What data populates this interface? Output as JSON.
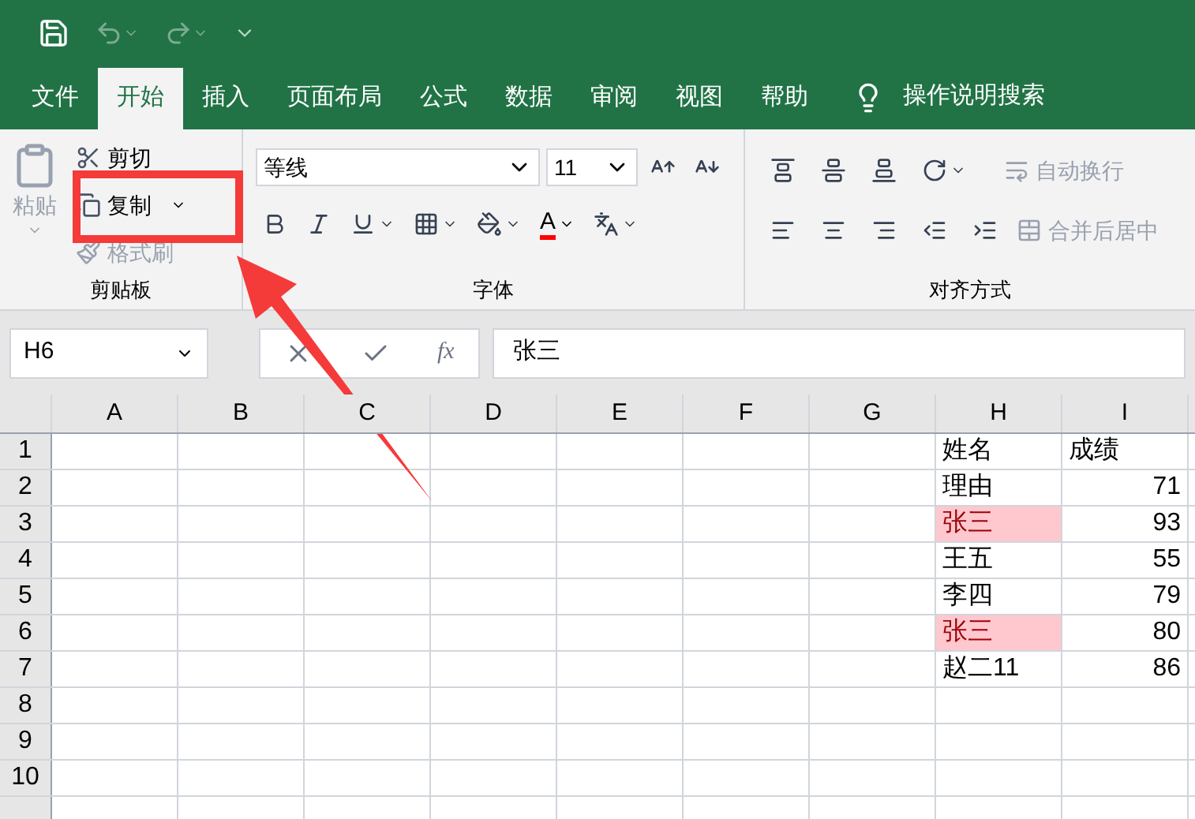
{
  "tabs": [
    {
      "label": "文件",
      "selected": false
    },
    {
      "label": "开始",
      "selected": true
    },
    {
      "label": "插入",
      "selected": false
    },
    {
      "label": "页面布局",
      "selected": false
    },
    {
      "label": "公式",
      "selected": false
    },
    {
      "label": "数据",
      "selected": false
    },
    {
      "label": "审阅",
      "selected": false
    },
    {
      "label": "视图",
      "selected": false
    },
    {
      "label": "帮助",
      "selected": false
    }
  ],
  "tell_me": "操作说明搜索",
  "ribbon": {
    "clipboard": {
      "paste": "粘贴",
      "cut": "剪切",
      "copy": "复制",
      "format_painter": "格式刷",
      "format_painter_disabled": true,
      "label": "剪贴板"
    },
    "font": {
      "name": "等线",
      "size": "11",
      "font_color_label": "A",
      "label": "字体"
    },
    "alignment": {
      "wrap_text": "自动换行",
      "merge_center": "合并后居中",
      "label": "对齐方式"
    }
  },
  "formula_bar": {
    "name_box": "H6",
    "fx": "fx",
    "value": "张三"
  },
  "columns": [
    "A",
    "B",
    "C",
    "D",
    "E",
    "F",
    "G",
    "H",
    "I"
  ],
  "rows": [
    {
      "number": "1",
      "h": {
        "text": "姓名",
        "highlighted": false
      },
      "i": "成绩"
    },
    {
      "number": "2",
      "h": {
        "text": "理由",
        "highlighted": false
      },
      "i": "71"
    },
    {
      "number": "3",
      "h": {
        "text": "张三",
        "highlighted": true
      },
      "i": "93"
    },
    {
      "number": "4",
      "h": {
        "text": "王五",
        "highlighted": false
      },
      "i": "55"
    },
    {
      "number": "5",
      "h": {
        "text": "李四",
        "highlighted": false
      },
      "i": "79"
    },
    {
      "number": "6",
      "h": {
        "text": "张三",
        "highlighted": true
      },
      "i": "80"
    },
    {
      "number": "7",
      "h": {
        "text": "赵二11",
        "highlighted": false
      },
      "i": "86"
    },
    {
      "number": "8"
    },
    {
      "number": "9"
    },
    {
      "number": "10"
    }
  ]
}
